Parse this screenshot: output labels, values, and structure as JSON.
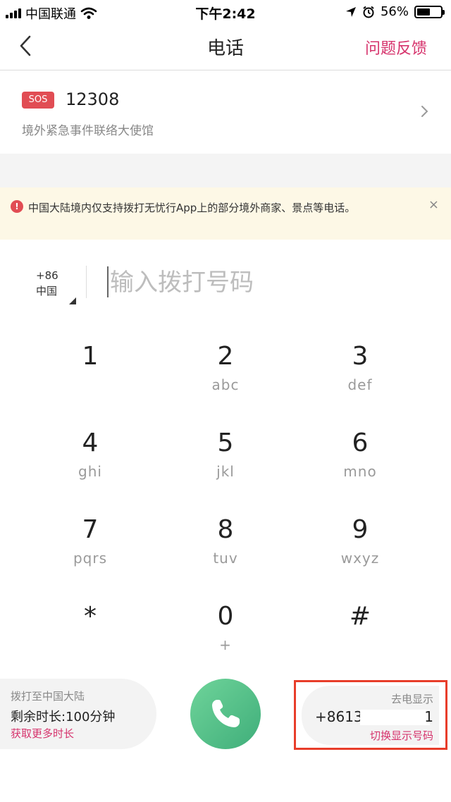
{
  "status_bar": {
    "carrier": "中国联通",
    "time": "下午2:42",
    "battery_percent": "56%",
    "battery_level": 0.56
  },
  "nav": {
    "title": "电话",
    "feedback_label": "问题反馈"
  },
  "sos": {
    "badge": "SOS",
    "number": "12308",
    "description": "境外紧急事件联络大使馆"
  },
  "notice": {
    "icon_text": "!",
    "text": "中国大陆境内仅支持拨打无忧行App上的部分境外商家、景点等电话。",
    "close_symbol": "×"
  },
  "dial_input": {
    "country_code": "+86",
    "country_name": "中国",
    "placeholder": "输入拨打号码"
  },
  "keypad": [
    {
      "digit": "1",
      "letters": ""
    },
    {
      "digit": "2",
      "letters": "abc"
    },
    {
      "digit": "3",
      "letters": "def"
    },
    {
      "digit": "4",
      "letters": "ghi"
    },
    {
      "digit": "5",
      "letters": "jkl"
    },
    {
      "digit": "6",
      "letters": "mno"
    },
    {
      "digit": "7",
      "letters": "pqrs"
    },
    {
      "digit": "8",
      "letters": "tuv"
    },
    {
      "digit": "9",
      "letters": "wxyz"
    },
    {
      "digit": "*",
      "letters": ""
    },
    {
      "digit": "0",
      "letters": "+"
    },
    {
      "digit": "#",
      "letters": ""
    }
  ],
  "remaining": {
    "title": "拨打至中国大陆",
    "time_text": "剩余时长:100分钟",
    "link": "获取更多时长"
  },
  "caller_id": {
    "title": "去电显示",
    "number_prefix": "+8613",
    "number_suffix": "1",
    "switch_label": "切换显示号码"
  },
  "colors": {
    "accent": "#d6336c",
    "sos_red": "#e14d54",
    "call_green": "#4cbf85",
    "highlight_red": "#e83d2a"
  }
}
